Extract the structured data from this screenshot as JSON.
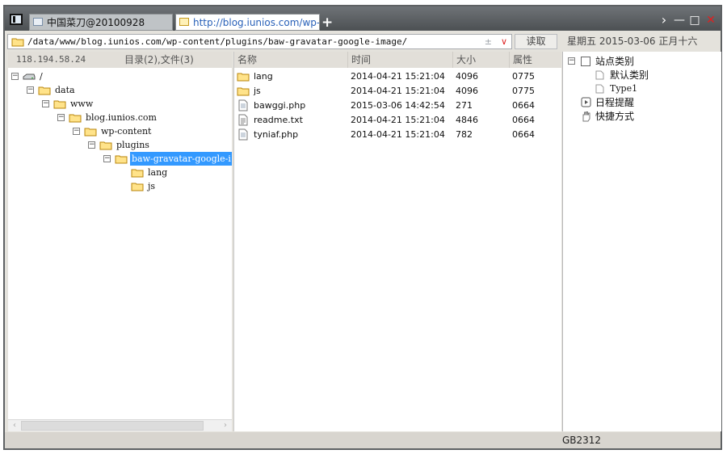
{
  "tabs": [
    {
      "label": "中国菜刀@20100928"
    },
    {
      "label": "http://blog.iunios.com/wp-co..."
    }
  ],
  "new_tab_label": "+",
  "window_controls": {
    "nav": "›",
    "minimize": "—",
    "maximize": "□",
    "close": "✕"
  },
  "address": {
    "path": "/data/www/blog.iunios.com/wp-content/plugins/baw-gravatar-google-image/",
    "plusminus": "±",
    "dropdown": "∨"
  },
  "read_button": "读取",
  "datetime": "星期五 2015-03-06 正月十六",
  "left": {
    "ip": "118.194.58.24",
    "counts": "目录(2),文件(3)",
    "tree": [
      {
        "label": "/",
        "icon": "drive-icon"
      },
      {
        "label": "data",
        "icon": "folder-icon"
      },
      {
        "label": "www",
        "icon": "folder-icon"
      },
      {
        "label": "blog.iunios.com",
        "icon": "folder-icon"
      },
      {
        "label": "wp-content",
        "icon": "folder-icon"
      },
      {
        "label": "plugins",
        "icon": "folder-icon"
      },
      {
        "label": "baw-gravatar-google-i",
        "icon": "folder-icon",
        "selected": true
      },
      {
        "label": "lang",
        "icon": "folder-icon"
      },
      {
        "label": "js",
        "icon": "folder-icon"
      }
    ]
  },
  "files": {
    "columns": [
      "名称",
      "时间",
      "大小",
      "属性"
    ],
    "rows": [
      {
        "name": "lang",
        "time": "2014-04-21 15:21:04",
        "size": "4096",
        "attr": "0775",
        "icon": "folder-icon"
      },
      {
        "name": "js",
        "time": "2014-04-21 15:21:04",
        "size": "4096",
        "attr": "0775",
        "icon": "folder-icon"
      },
      {
        "name": "bawggi.php",
        "time": "2015-03-06 14:42:54",
        "size": "271",
        "attr": "0664",
        "icon": "file-icon"
      },
      {
        "name": "readme.txt",
        "time": "2014-04-21 15:21:04",
        "size": "4846",
        "attr": "0664",
        "icon": "text-file-icon"
      },
      {
        "name": "tyniaf.php",
        "time": "2014-04-21 15:21:04",
        "size": "782",
        "attr": "0664",
        "icon": "file-icon"
      }
    ]
  },
  "right": {
    "items": [
      {
        "label": "站点类别",
        "icon": "checkbox-icon"
      },
      {
        "label": "默认类别",
        "icon": "page-icon"
      },
      {
        "label": "Type1",
        "icon": "page-icon"
      },
      {
        "label": "日程提醒",
        "icon": "clock-icon"
      },
      {
        "label": "快捷方式",
        "icon": "hand-icon"
      }
    ]
  },
  "status": {
    "encoding": "GB2312"
  },
  "colors": {
    "selection": "#3399ff",
    "close": "#e02020",
    "tab_link": "#2860b8"
  }
}
